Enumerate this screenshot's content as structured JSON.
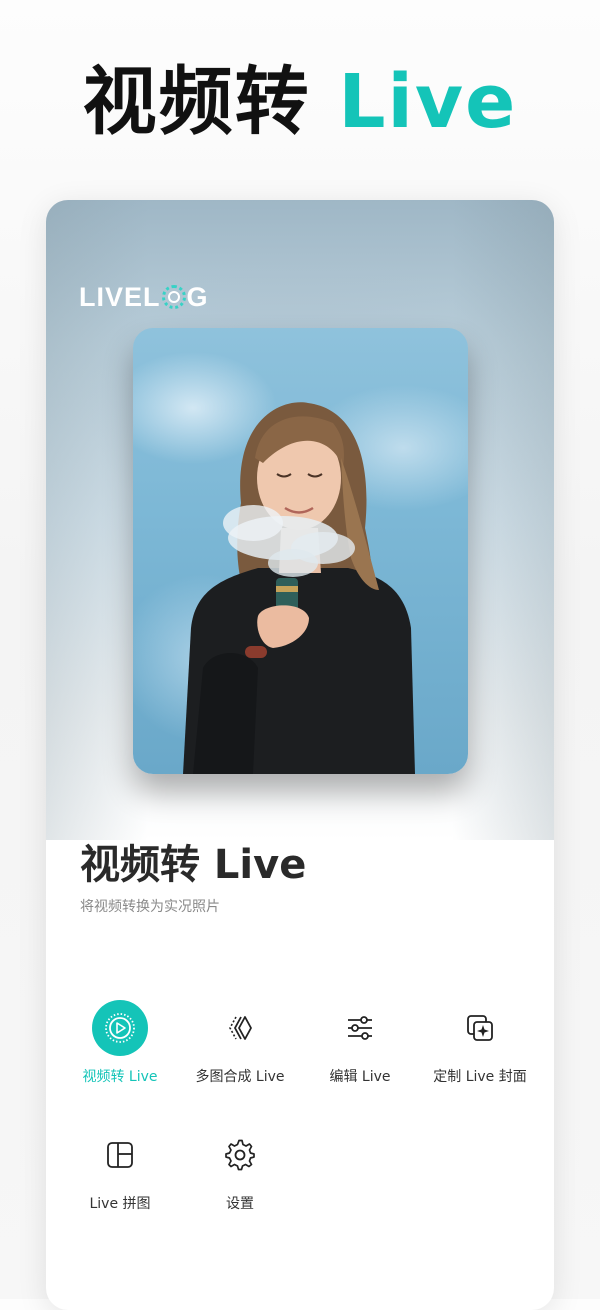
{
  "promo": {
    "title_main": "视频转",
    "title_accent": "Live"
  },
  "logo": {
    "text_before": "LIVEL",
    "text_after": "G"
  },
  "feature": {
    "title": "视频转 Live",
    "subtitle": "将视频转换为实况照片"
  },
  "menu": {
    "items": [
      {
        "label": "视频转 Live",
        "icon": "play-circle-icon",
        "active": true
      },
      {
        "label": "多图合成 Live",
        "icon": "merge-chevrons-icon",
        "active": false
      },
      {
        "label": "编辑 Live",
        "icon": "sliders-icon",
        "active": false
      },
      {
        "label": "定制 Live 封面",
        "icon": "cover-sparkle-icon",
        "active": false
      },
      {
        "label": "Live 拼图",
        "icon": "collage-grid-icon",
        "active": false
      },
      {
        "label": "设置",
        "icon": "gear-icon",
        "active": false
      }
    ]
  },
  "colors": {
    "accent": "#14c4b8",
    "text_dark": "#2a2a2a",
    "text_muted": "#8a8a8a"
  }
}
